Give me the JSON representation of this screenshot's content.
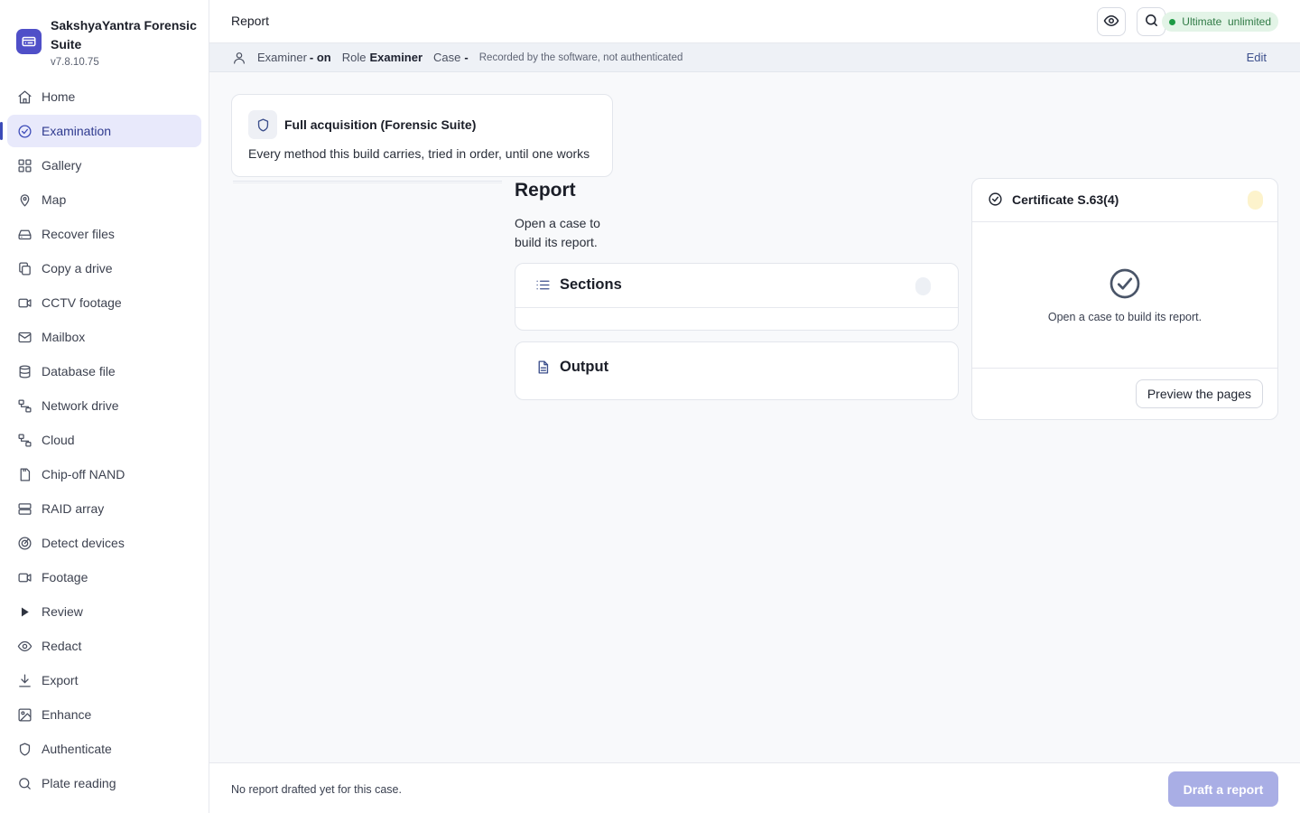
{
  "app": {
    "name": "SakshyaYantra Forensic Suite",
    "version": "v7.8.10.75",
    "accent": "#4f4fc8"
  },
  "sidebar": {
    "items": [
      {
        "label": "Home",
        "icon": "home-icon",
        "active": false
      },
      {
        "label": "Examination",
        "icon": "check-circle-icon",
        "active": true
      },
      {
        "label": "Gallery",
        "icon": "grid-icon",
        "active": false
      },
      {
        "label": "Map",
        "icon": "map-pin-icon",
        "active": false
      },
      {
        "label": "Recover files",
        "icon": "drive-icon",
        "active": false
      },
      {
        "label": "Copy a drive",
        "icon": "copy-icon",
        "active": false
      },
      {
        "label": "CCTV footage",
        "icon": "video-icon",
        "active": false
      },
      {
        "label": "Mailbox",
        "icon": "mail-icon",
        "active": false
      },
      {
        "label": "Database file",
        "icon": "database-icon",
        "active": false
      },
      {
        "label": "Network drive",
        "icon": "network-icon",
        "active": false
      },
      {
        "label": "Cloud",
        "icon": "network-icon",
        "active": false
      },
      {
        "label": "Chip-off NAND",
        "icon": "chip-icon",
        "active": false
      },
      {
        "label": "RAID array",
        "icon": "server-icon",
        "active": false
      },
      {
        "label": "Detect devices",
        "icon": "radar-icon",
        "active": false
      },
      {
        "label": "Footage",
        "icon": "video-icon",
        "active": false
      },
      {
        "label": "Review",
        "icon": "play-icon",
        "active": false
      },
      {
        "label": "Redact",
        "icon": "eye-icon",
        "active": false
      },
      {
        "label": "Export",
        "icon": "download-icon",
        "active": false
      },
      {
        "label": "Enhance",
        "icon": "image-icon",
        "active": false
      },
      {
        "label": "Authenticate",
        "icon": "shield-icon",
        "active": false
      },
      {
        "label": "Plate reading",
        "icon": "search-icon",
        "active": false
      }
    ]
  },
  "topbar": {
    "title": "Report",
    "license_label": "Ultimate  unlimited",
    "license_color": "#1e9a45"
  },
  "infobar": {
    "examiner_label": "Examiner",
    "examiner_value": "- on",
    "role_label": "Role",
    "role_value": "Examiner",
    "case_label": "Case",
    "case_value": "-",
    "note": "Recorded by the software, not authenticated",
    "edit_label": "Edit"
  },
  "acquisition": {
    "title": "Full acquisition (Forensic Suite)",
    "description": "Every method this build carries, tried in order, until one works"
  },
  "report": {
    "title": "Report",
    "subtitle": "Open a case to build its report.",
    "sections_title": "Sections",
    "output_title": "Output"
  },
  "certificate": {
    "title": "Certificate S.63(4)",
    "message": "Open a case to build its report.",
    "preview_label": "Preview the pages"
  },
  "footer": {
    "note": "No report drafted yet for this case.",
    "draft_label": "Draft a report"
  }
}
